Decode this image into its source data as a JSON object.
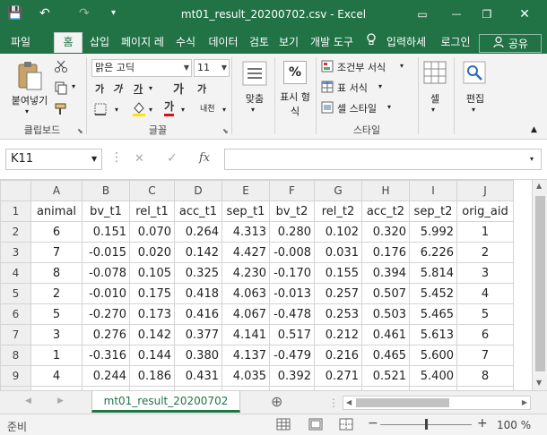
{
  "title_bar": {
    "document_title": "mt01_result_20200702.csv - Excel",
    "save_icon": "💾",
    "undo_icon": "↶",
    "redo_icon": "↷",
    "customize_icon": "▾",
    "minimize": "—",
    "restore": "❐",
    "close": "✕",
    "ribbon_display": "▭"
  },
  "tabs": [
    {
      "label": "파일"
    },
    {
      "label": "홈"
    },
    {
      "label": "삽입"
    },
    {
      "label": "페이지 레"
    },
    {
      "label": "수식"
    },
    {
      "label": "데이터"
    },
    {
      "label": "검토"
    },
    {
      "label": "보기"
    },
    {
      "label": "개발 도구"
    },
    {
      "label": "입력하세"
    },
    {
      "label": "로그인"
    },
    {
      "label": "공유"
    }
  ],
  "ribbon": {
    "clipboard": {
      "paste_label": "붙여넣기",
      "group_label": "클립보드"
    },
    "font": {
      "font_name": "맑은 고딕",
      "font_size": "11",
      "bold": "가",
      "italic": "가",
      "underline": "가",
      "grow": "가",
      "shrink": "가",
      "font_color_glyph": "가",
      "phonetic": "내천",
      "group_label": "글꼴"
    },
    "alignment": {
      "label": "맞춤"
    },
    "number": {
      "symbol": "%",
      "label_line1": "표시 형",
      "label_line2": "식"
    },
    "styles": {
      "conditional": "조건부 서식",
      "table": "표 서식",
      "cell_styles": "셀 스타일",
      "group_label": "스타일"
    },
    "cells": {
      "label": "셀"
    },
    "editing": {
      "label": "편집"
    }
  },
  "formula_bar": {
    "name_box": "K11",
    "cancel": "✕",
    "enter": "✓",
    "fx": "fx",
    "value": ""
  },
  "sheet": {
    "column_letters": [
      "A",
      "B",
      "C",
      "D",
      "E",
      "F",
      "G",
      "H",
      "I",
      "J"
    ],
    "row_numbers": [
      "1",
      "2",
      "3",
      "4",
      "5",
      "6",
      "7",
      "8",
      "9",
      "10"
    ],
    "rows": [
      [
        "animal",
        "bv_t1",
        "rel_t1",
        "acc_t1",
        "sep_t1",
        "bv_t2",
        "rel_t2",
        "acc_t2",
        "sep_t2",
        "orig_aid"
      ],
      [
        "6",
        "0.151",
        "0.070",
        "0.264",
        "4.313",
        "0.280",
        "0.102",
        "0.320",
        "5.992",
        "1"
      ],
      [
        "7",
        "-0.015",
        "0.020",
        "0.142",
        "4.427",
        "-0.008",
        "0.031",
        "0.176",
        "6.226",
        "2"
      ],
      [
        "8",
        "-0.078",
        "0.105",
        "0.325",
        "4.230",
        "-0.170",
        "0.155",
        "0.394",
        "5.814",
        "3"
      ],
      [
        "2",
        "-0.010",
        "0.175",
        "0.418",
        "4.063",
        "-0.013",
        "0.257",
        "0.507",
        "5.452",
        "4"
      ],
      [
        "5",
        "-0.270",
        "0.173",
        "0.416",
        "4.067",
        "-0.478",
        "0.253",
        "0.503",
        "5.465",
        "5"
      ],
      [
        "3",
        "0.276",
        "0.142",
        "0.377",
        "4.141",
        "0.517",
        "0.212",
        "0.461",
        "5.613",
        "6"
      ],
      [
        "1",
        "-0.316",
        "0.144",
        "0.380",
        "4.137",
        "-0.479",
        "0.216",
        "0.465",
        "5.600",
        "7"
      ],
      [
        "4",
        "0.244",
        "0.186",
        "0.431",
        "4.035",
        "0.392",
        "0.271",
        "0.521",
        "5.400",
        "8"
      ],
      [
        "",
        "",
        "",
        "",
        "",
        "",
        "",
        "",
        "",
        ""
      ]
    ]
  },
  "sheet_tabs": {
    "active": "mt01_result_20200702",
    "add_icon": "⊕"
  },
  "status_bar": {
    "status": "준비",
    "zoom": "100 %",
    "zoom_out": "−",
    "zoom_in": "+"
  },
  "colors": {
    "brand": "#217346",
    "underline_red": "#d11",
    "highlight_yellow": "#ffe600"
  }
}
